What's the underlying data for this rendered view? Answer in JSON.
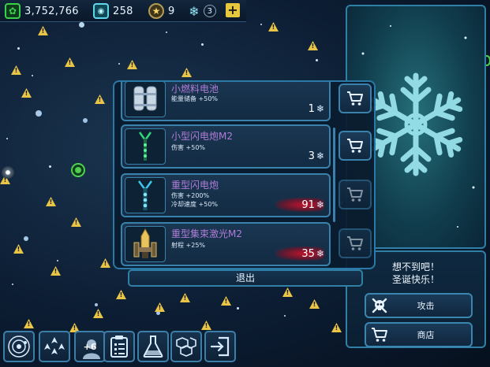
{
  "resources": {
    "credits": "3,752,766",
    "crew": "258",
    "stars": "9",
    "snowflakes": "3"
  },
  "store": {
    "items": [
      {
        "name": "小燃料电池",
        "stats": [
          "能量储备 +50%"
        ],
        "price": "1",
        "affordable": true
      },
      {
        "name": "小型闪电炮M2",
        "stats": [
          "伤害 +50%"
        ],
        "price": "3",
        "affordable": true
      },
      {
        "name": "重型闪电炮",
        "stats": [
          "伤害 +200%",
          "冷却速度 +50%"
        ],
        "price": "91",
        "affordable": false
      },
      {
        "name": "重型集束激光M2",
        "stats": [
          "射程 +25%"
        ],
        "price": "35",
        "affordable": false
      }
    ],
    "exit_label": "退出"
  },
  "promo": {
    "message_line1": "想不到吧！",
    "message_line2": "圣诞快乐！",
    "attack_label": "攻击",
    "shop_label": "商店"
  },
  "toolbar": {
    "crew_badge": "+6"
  },
  "colors": {
    "accent": "#2f7fa6",
    "item_name": "#b07dd8",
    "price_unaffordable": "#c0132c",
    "hazard": "#e8c547"
  },
  "icons": [
    "credits-icon",
    "crew-icon",
    "star-icon",
    "snowflake-icon",
    "add-icon",
    "cart-icon",
    "skull-icon",
    "galaxy-icon",
    "fleet-icon",
    "crew-icon",
    "clipboard-icon",
    "flask-icon",
    "cubes-icon",
    "exit-icon"
  ]
}
